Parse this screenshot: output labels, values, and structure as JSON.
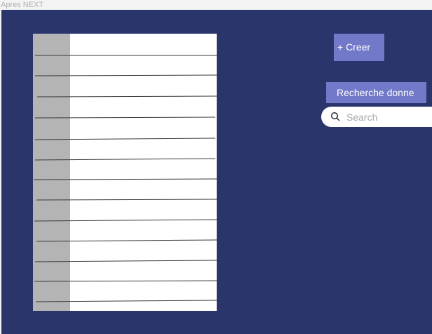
{
  "window": {
    "title": "Apres NEXT"
  },
  "toolbar": {
    "create_label": "+ Creer",
    "search_data_label": "Recherche donne"
  },
  "search": {
    "placeholder": "Search",
    "value": "",
    "icon": "search-icon"
  },
  "table": {
    "row_count": 14
  },
  "colors": {
    "background": "#29356B",
    "accent": "#7279C8",
    "side_column": "#B4B4B4",
    "table_background": "#FFFFFF"
  }
}
